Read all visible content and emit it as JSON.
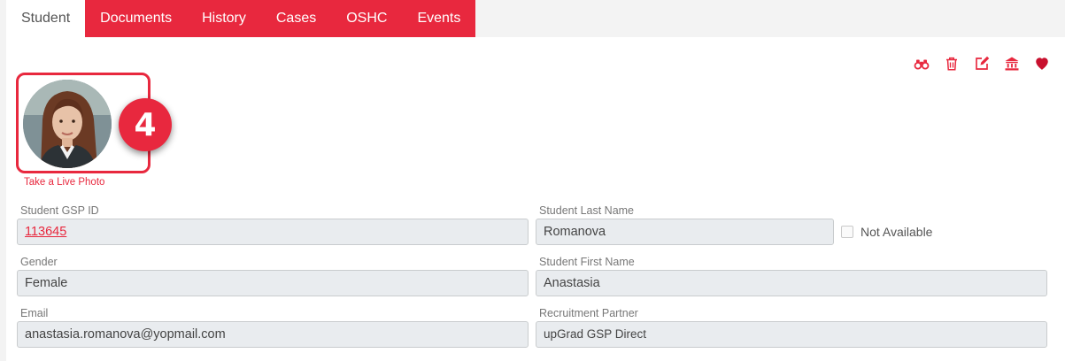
{
  "tabs": [
    "Student",
    "Documents",
    "History",
    "Cases",
    "OSHC",
    "Events"
  ],
  "actions": [
    "binoculars-icon",
    "trash-icon",
    "edit-icon",
    "bank-icon",
    "heart-icon"
  ],
  "colors": {
    "accent": "#e8283e",
    "field_bg": "#e9ecef"
  },
  "photo": {
    "badge": "4",
    "link": "Take a Live Photo"
  },
  "form": {
    "gsp_id": {
      "label": "Student GSP ID",
      "value": "113645"
    },
    "last_name": {
      "label": "Student Last Name",
      "value": "Romanova"
    },
    "not_available": "Not Available",
    "gender": {
      "label": "Gender",
      "value": "Female"
    },
    "first_name": {
      "label": "Student First Name",
      "value": "Anastasia"
    },
    "email": {
      "label": "Email",
      "value": "anastasia.romanova@yopmail.com"
    },
    "partner": {
      "label": "Recruitment Partner",
      "value": "upGrad GSP Direct"
    }
  }
}
